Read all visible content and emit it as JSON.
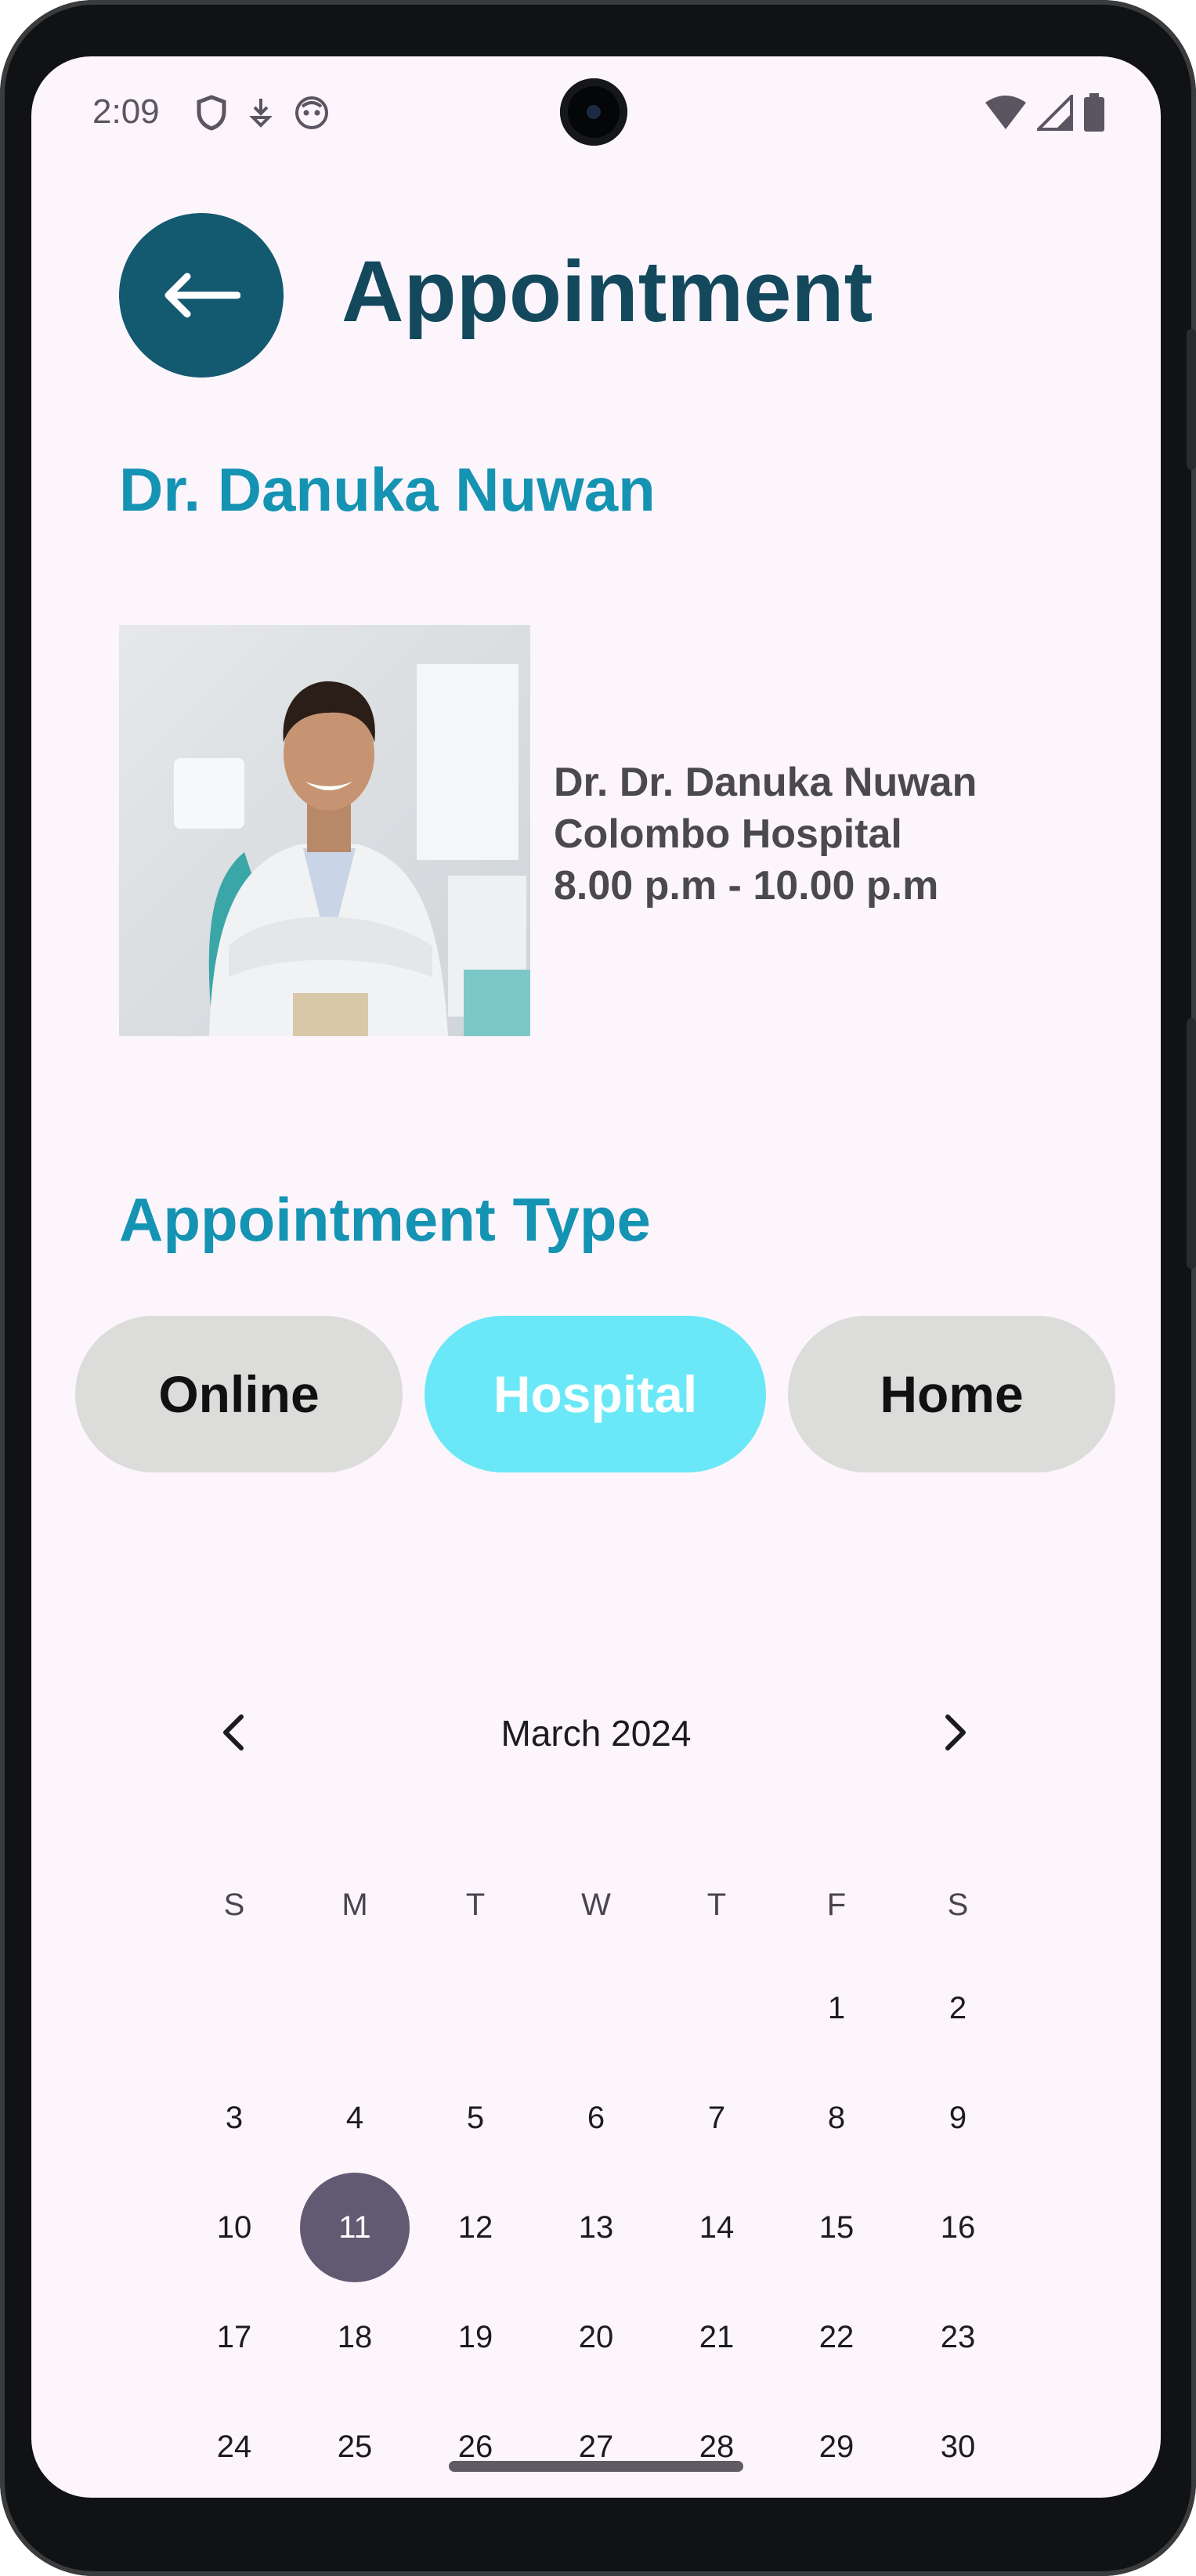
{
  "status_bar": {
    "time": "2:09",
    "left_icons": [
      "shield-icon",
      "download-icon",
      "app-face-icon"
    ],
    "right_icons": [
      "wifi-icon",
      "signal-icon",
      "battery-icon"
    ]
  },
  "header": {
    "title": "Appointment",
    "back_icon": "arrow-left-icon"
  },
  "doctor": {
    "heading": "Dr. Danuka Nuwan",
    "info_lines": [
      "Dr. Dr. Danuka Nuwan",
      "Colombo Hospital",
      "8.00 p.m - 10.00 p.m"
    ]
  },
  "appointment_type": {
    "heading": "Appointment Type",
    "options": [
      {
        "label": "Online",
        "selected": false
      },
      {
        "label": "Hospital",
        "selected": true
      },
      {
        "label": "Home",
        "selected": false
      }
    ]
  },
  "calendar": {
    "month_label": "March 2024",
    "prev_icon": "chevron-left-icon",
    "next_icon": "chevron-right-icon",
    "weekdays": [
      "S",
      "M",
      "T",
      "W",
      "T",
      "F",
      "S"
    ],
    "first_weekday_index": 5,
    "visible_days": [
      "1",
      "2",
      "3",
      "4",
      "5",
      "6",
      "7",
      "8",
      "9",
      "10",
      "11",
      "12",
      "13",
      "14",
      "15",
      "16",
      "17",
      "18",
      "19",
      "20",
      "21",
      "22",
      "23",
      "24",
      "25",
      "26",
      "27",
      "28",
      "29",
      "30"
    ],
    "selected_day": "11"
  },
  "colors": {
    "screen_bg": "#fcf5fc",
    "back_button": "#135a70",
    "title": "#14495d",
    "accent_heading": "#1593b2",
    "chip_selected": "#6ae8f7",
    "chip_default": "#dcdcda",
    "calendar_selected": "#615a72"
  }
}
